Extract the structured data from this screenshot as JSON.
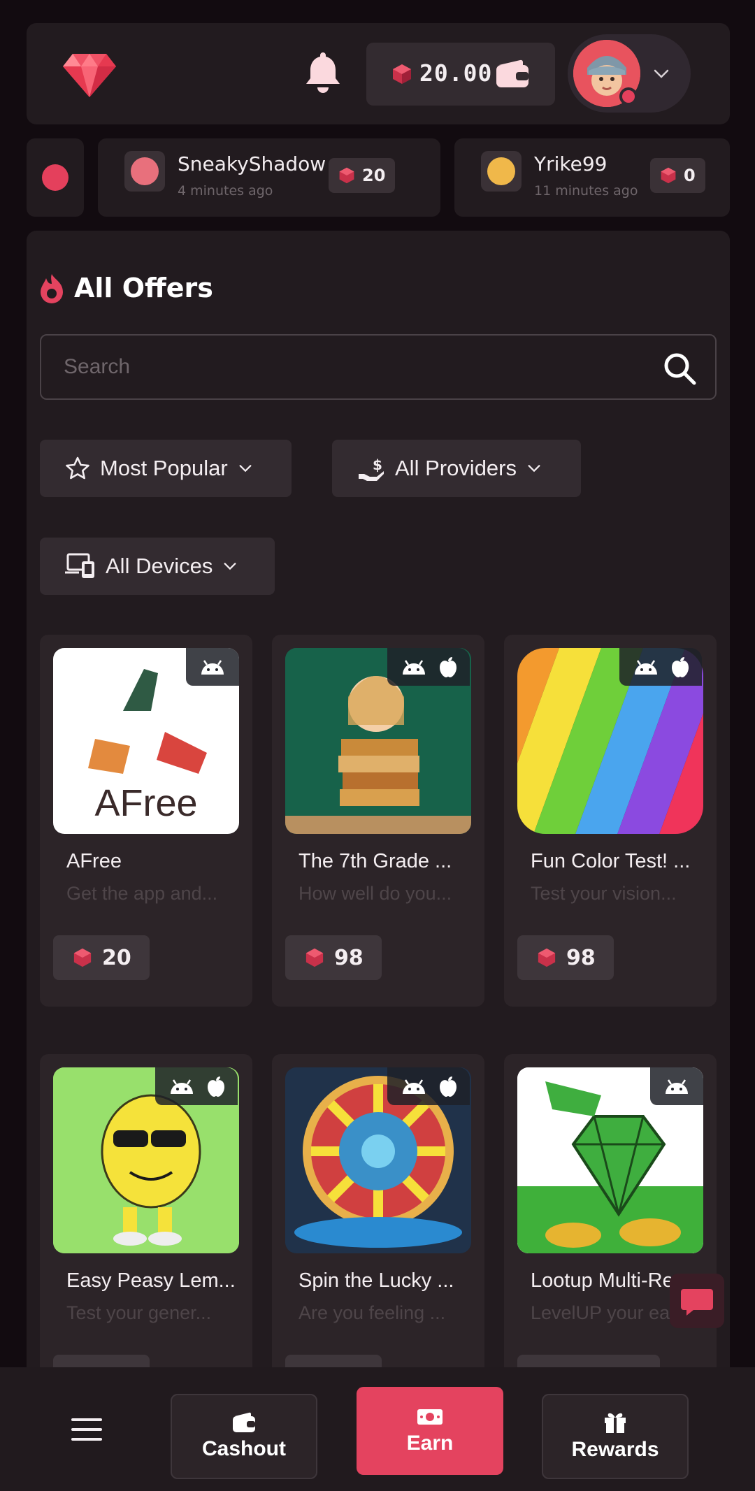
{
  "colors": {
    "accent": "#e4435f",
    "background": "#120b10",
    "panel": "#221b1f",
    "card": "#2c2428"
  },
  "header": {
    "logo_icon": "ruby-gem-logo-icon",
    "notifications_icon": "bell-icon",
    "balance": "20.00",
    "balance_icon": "ruby-icon",
    "wallet_icon": "wallet-icon",
    "dropdown_icon": "chevron-down-icon"
  },
  "activity_feed": [
    {
      "name": "SneakyShadow",
      "time": "4 minutes ago",
      "amount": "20"
    },
    {
      "name": "Yrike99",
      "time": "11 minutes ago",
      "amount": "0"
    }
  ],
  "offers": {
    "title": "All Offers",
    "title_icon": "fire-icon",
    "search_placeholder": "Search",
    "filters": {
      "sort": "Most Popular",
      "providers": "All Providers",
      "devices": "All Devices"
    },
    "cards": [
      {
        "title": "AFree",
        "description": "Get the app and...",
        "reward": "20",
        "platforms": [
          "android"
        ]
      },
      {
        "title": "The 7th Grade ...",
        "description": "How well do you...",
        "reward": "98",
        "platforms": [
          "android",
          "apple"
        ]
      },
      {
        "title": "Fun Color Test! ...",
        "description": "Test your vision...",
        "reward": "98",
        "platforms": [
          "android",
          "apple"
        ]
      },
      {
        "title": "Easy Peasy Lem...",
        "description": "Test your gener...",
        "reward": "",
        "platforms": [
          "android",
          "apple"
        ]
      },
      {
        "title": "Spin the Lucky ...",
        "description": "Are you feeling ...",
        "reward": "",
        "platforms": [
          "android",
          "apple"
        ]
      },
      {
        "title": "Lootup Multi-Re",
        "description": "LevelUP your ea",
        "reward": "",
        "platforms": [
          "android"
        ]
      }
    ]
  },
  "bottom_nav": {
    "menu_icon": "hamburger-menu-icon",
    "cashout": "Cashout",
    "earn": "Earn",
    "rewards": "Rewards"
  }
}
